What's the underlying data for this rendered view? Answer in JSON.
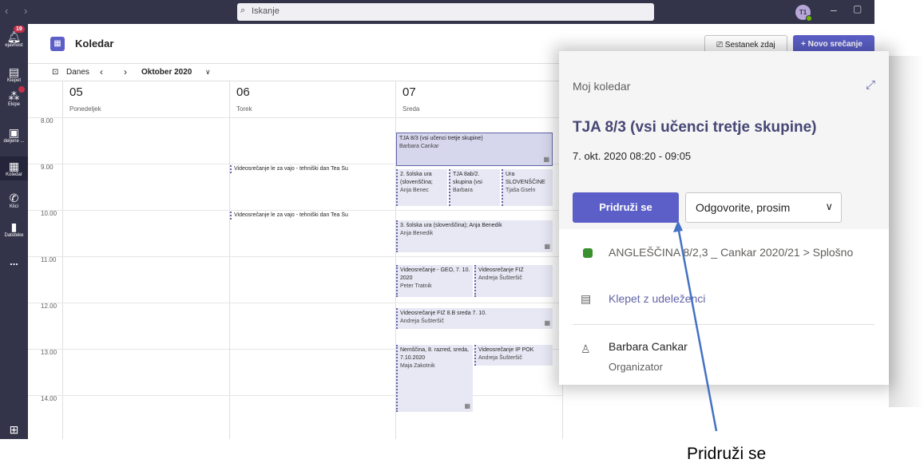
{
  "topbar": {
    "nav_glyph": "‹ ›",
    "search_placeholder": "Iskanje",
    "search_icon": "search-icon",
    "avatar_initials": "T1",
    "minimize_glyph": "–",
    "maximize_glyph": "▢"
  },
  "rail": {
    "activity": {
      "label": "ejavnost",
      "badge": "19",
      "icon": "bell-icon"
    },
    "chat": {
      "label": "Klepet",
      "icon": "chat-icon"
    },
    "teams": {
      "label": "Ekipe",
      "icon": "teams-icon"
    },
    "assignments": {
      "label": "deljene ...",
      "icon": "assignments-icon"
    },
    "calendar": {
      "label": "Koledar",
      "icon": "calendar-icon"
    },
    "calls": {
      "label": "Klici",
      "icon": "phone-icon"
    },
    "files": {
      "label": "Datoteke",
      "icon": "file-icon"
    },
    "more": {
      "label": "...",
      "icon": "more-icon"
    },
    "apps": {
      "icon": "apps-icon"
    }
  },
  "header": {
    "title": "Koledar",
    "meet_now": "Sestanek zdaj",
    "new_meeting": "Novo srečanje"
  },
  "toolbar": {
    "today": "Danes",
    "month": "Oktober 2020"
  },
  "days": [
    {
      "num": "05",
      "name": "Ponedeljek"
    },
    {
      "num": "06",
      "name": "Torek"
    },
    {
      "num": "07",
      "name": "Sreda"
    }
  ],
  "times": [
    "8.00",
    "9.00",
    "10.00",
    "11.00",
    "12.00",
    "13.00",
    "14.00"
  ],
  "events": {
    "tue1": "Videosrečanje le za vajo - tehniški dan  Tea Šu",
    "tue2": "Videosrečanje le za vajo - tehniški dan  Tea Šu",
    "wed1_title": "TJA 8/3 (vsi učenci tretje skupine)",
    "wed1_org": "Barbara Cankar",
    "wed2a": "2. šolska ura (slovenščina;",
    "wed2a_org": "Anja Benec",
    "wed2b": "TJA 8ab/2. skupina (vsi",
    "wed2b_org": "Barbara",
    "wed2c": "Ura SLOVENŠČINE",
    "wed2c_org": "Tjaša Gseln",
    "wed3_title": "3. šolska ura (slovenščina); Anja Benedik",
    "wed3_org": "Anja Benedik",
    "wed4a_title": "Videosrečanje - GEO, 7. 10. 2020",
    "wed4a_org": "Peter Tratnik",
    "wed4b_title": "Videosrečanje FIZ",
    "wed4b_org": "Andreja Šušteršič",
    "wed5_title": "Videosrečanje FIZ 8.B sreda 7. 10.",
    "wed5_org": "Andreja Šušteršič",
    "wed6a_title": "Nemščina, 8. razred, sreda, 7.10.2020",
    "wed6a_org": "Maja Zakotnik",
    "wed6b_title": "Videosrečanje IP POK",
    "wed6b_org": "Andreja Šušteršič"
  },
  "popup": {
    "my_calendar": "Moj koledar",
    "title": "TJA 8/3 (vsi učenci tretje skupine)",
    "time": "7. okt. 2020 08:20 - 09:05",
    "join": "Pridruži se",
    "rsvp": "Odgovorite, prosim",
    "team": "ANGLEŠČINA 8/2,3 _ Cankar 2020/21 > Splošno",
    "chat": "Klepet z udeleženci",
    "organizer_name": "Barbara Cankar",
    "organizer_role": "Organizator"
  },
  "annotation": {
    "caption": "Pridruži se",
    "arrow_color": "#4472c4"
  }
}
